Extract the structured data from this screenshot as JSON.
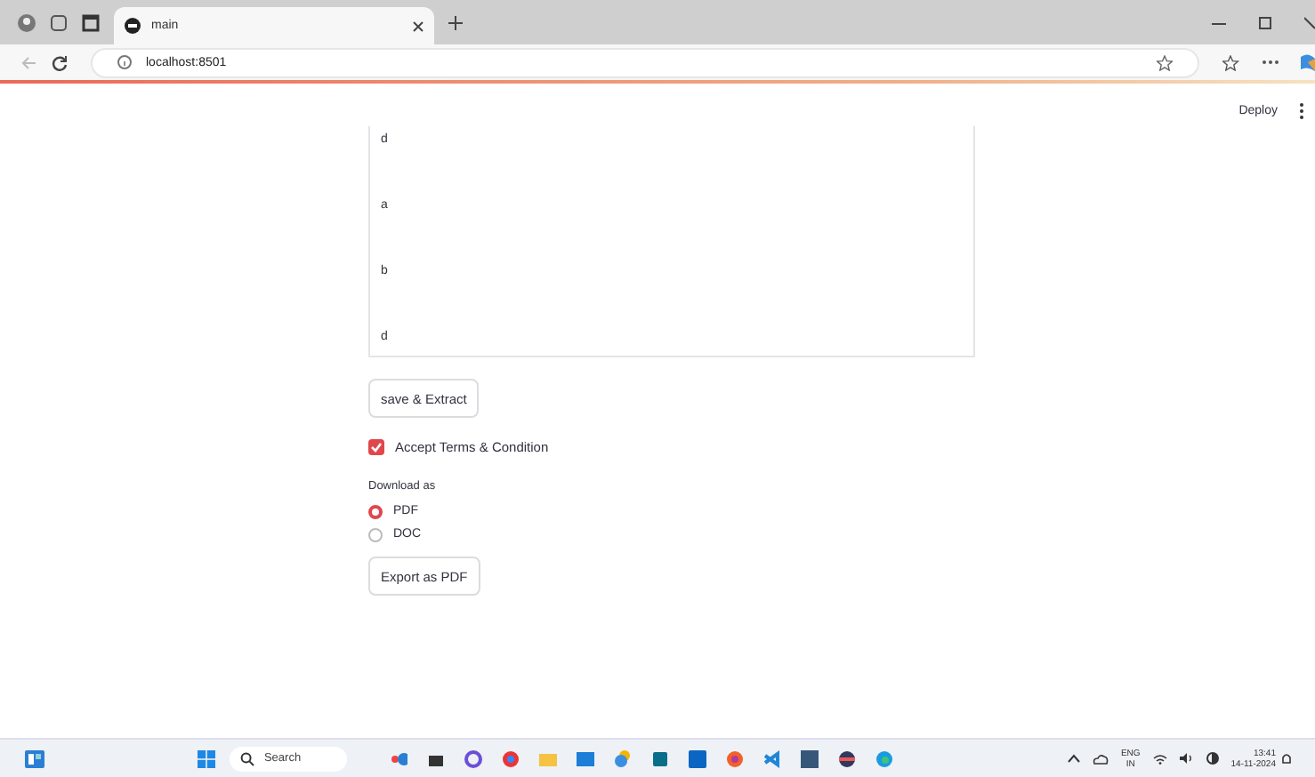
{
  "browser": {
    "tab_title": "main",
    "address": "localhost:8501"
  },
  "header": {
    "deploy": "Deploy"
  },
  "text_area": {
    "lines": [
      "d",
      "a",
      "b",
      "d"
    ]
  },
  "extract_button": "save & Extract",
  "terms_checkbox": {
    "label": "Accept Terms & Condition",
    "checked": true
  },
  "download": {
    "label": "Download as",
    "options": [
      {
        "label": "PDF",
        "selected": true
      },
      {
        "label": "DOC",
        "selected": false
      }
    ]
  },
  "export_button": "Export as PDF",
  "taskbar": {
    "search": "Search",
    "language": "ENG",
    "region": "IN",
    "time": "13:41",
    "date": "14-11-2024"
  }
}
